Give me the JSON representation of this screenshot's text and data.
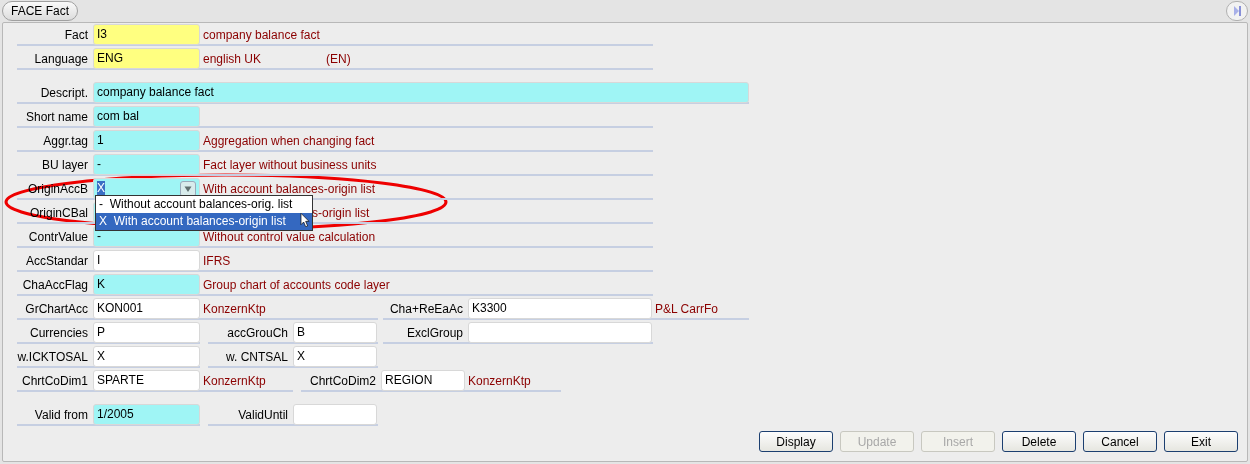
{
  "window": {
    "title": "FACE Fact"
  },
  "rows": [
    {
      "groups": [
        {
          "label": "Fact",
          "kind": "key",
          "value": "I3",
          "descriptions": [
            "company balance fact"
          ]
        }
      ]
    },
    {
      "groups": [
        {
          "label": "Language",
          "kind": "key",
          "value": "ENG",
          "descriptions": [
            "english UK",
            "(EN)"
          ]
        }
      ]
    },
    {
      "groups": [
        {
          "label": "Descript.",
          "kind": "required",
          "value": "company balance fact"
        }
      ]
    },
    {
      "groups": [
        {
          "label": "Short name",
          "kind": "required",
          "value": "com bal"
        }
      ]
    },
    {
      "groups": [
        {
          "label": "Aggr.tag",
          "kind": "required",
          "value": "1",
          "descriptions": [
            "Aggregation when changing fact"
          ]
        }
      ]
    },
    {
      "groups": [
        {
          "label": "BU layer",
          "kind": "required",
          "value": "-",
          "descriptions": [
            "Fact layer without business units"
          ]
        }
      ]
    },
    {
      "groups": [
        {
          "label": "OriginAccB",
          "kind": "combo",
          "value": "X",
          "descriptions": [
            "With account balances-origin list"
          ],
          "options": [
            {
              "code": "-",
              "text": "Without account balances-orig. list",
              "selected": false
            },
            {
              "code": "X",
              "text": "With account balances-origin list",
              "selected": true
            }
          ]
        }
      ]
    },
    {
      "groups": [
        {
          "label": "OriginCBal",
          "kind": "required",
          "covered": true,
          "descriptions": [
            "s-origin list"
          ]
        }
      ]
    },
    {
      "groups": [
        {
          "label": "ContrValue",
          "kind": "required",
          "value": "-",
          "descriptions": [
            "Without control value calculation"
          ]
        }
      ]
    },
    {
      "groups": [
        {
          "label": "AccStandar",
          "kind": "optional",
          "value": "I",
          "descriptions": [
            "IFRS"
          ]
        }
      ]
    },
    {
      "groups": [
        {
          "label": "ChaAccFlag",
          "kind": "required",
          "value": "K",
          "descriptions": [
            "Group chart of accounts code layer"
          ]
        }
      ]
    },
    {
      "groups": [
        {
          "label": "GrChartAcc",
          "kind": "optional",
          "value": "KON001",
          "descriptions": [
            "KonzernKtp"
          ]
        },
        {
          "label": "Cha+ReEaAc",
          "kind": "optional",
          "value": "K3300",
          "descriptions": [
            "P&L CarrFo"
          ]
        }
      ]
    },
    {
      "groups": [
        {
          "label": "Currencies",
          "kind": "optional",
          "value": "P"
        },
        {
          "label": "accGrouCh",
          "kind": "optional",
          "value": "B"
        },
        {
          "label": "ExclGroup",
          "kind": "optional"
        }
      ]
    },
    {
      "groups": [
        {
          "label": "w.ICKTOSAL",
          "kind": "optional",
          "value": "X"
        },
        {
          "label": "w. CNTSAL",
          "kind": "optional",
          "value": "X"
        }
      ]
    },
    {
      "groups": [
        {
          "label": "ChrtCoDim1",
          "kind": "optional",
          "value": "SPARTE",
          "descriptions": [
            "KonzernKtp"
          ]
        },
        {
          "label": "ChrtCoDim2",
          "kind": "optional",
          "value": "REGION",
          "descriptions": [
            "KonzernKtp"
          ]
        }
      ]
    },
    {
      "groups": [
        {
          "label": "Valid from",
          "kind": "required",
          "value": "1/2005"
        },
        {
          "label": "ValidUntil",
          "kind": "optional"
        }
      ]
    }
  ],
  "buttons": [
    {
      "label": "Display",
      "disabled": false
    },
    {
      "label": "Update",
      "disabled": true
    },
    {
      "label": "Insert",
      "disabled": true
    },
    {
      "label": "Delete",
      "disabled": false
    },
    {
      "label": "Cancel",
      "disabled": false
    },
    {
      "label": "Exit",
      "disabled": false
    }
  ]
}
